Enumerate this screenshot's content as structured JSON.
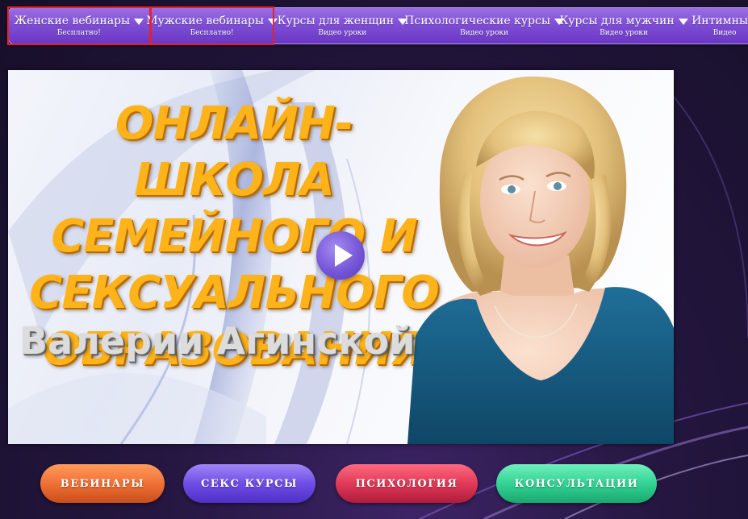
{
  "nav": {
    "items": [
      {
        "label": "Женские вебинары",
        "sub": "Бесплатно!"
      },
      {
        "label": "Мужские вебинары",
        "sub": "Бесплатно!"
      },
      {
        "label": "Курсы для женщин",
        "sub": "Видео уроки"
      },
      {
        "label": "Психологические курсы",
        "sub": "Видео уроки"
      },
      {
        "label": "Курсы для мужчин",
        "sub": "Видео уроки"
      },
      {
        "label": "Интимны",
        "sub": "Видео"
      }
    ]
  },
  "hero": {
    "title_lines": [
      "ОНЛАЙН-ШКОЛА",
      "СЕМЕЙНОГО И",
      "СЕКСУАЛЬНОГО",
      "ОБРАЗОВАНИЯ"
    ],
    "subtitle": "Валерии Агинской"
  },
  "buttons": {
    "webinars": "ВЕБИНАРЫ",
    "courses": "СЕКС КУРСЫ",
    "psychology": "ПСИХОЛОГИЯ",
    "consultations": "КОНСУЛЬТАЦИИ"
  },
  "colors": {
    "nav": "#7f4fd6",
    "highlight": "#e8202a",
    "title": "#ffb31a",
    "btn_orange": "#f07136",
    "btn_purple": "#6f4ee6",
    "btn_red": "#e03a58",
    "btn_green": "#33d394"
  },
  "icons": {
    "caret": "chevron-down-icon",
    "play": "play-icon"
  }
}
